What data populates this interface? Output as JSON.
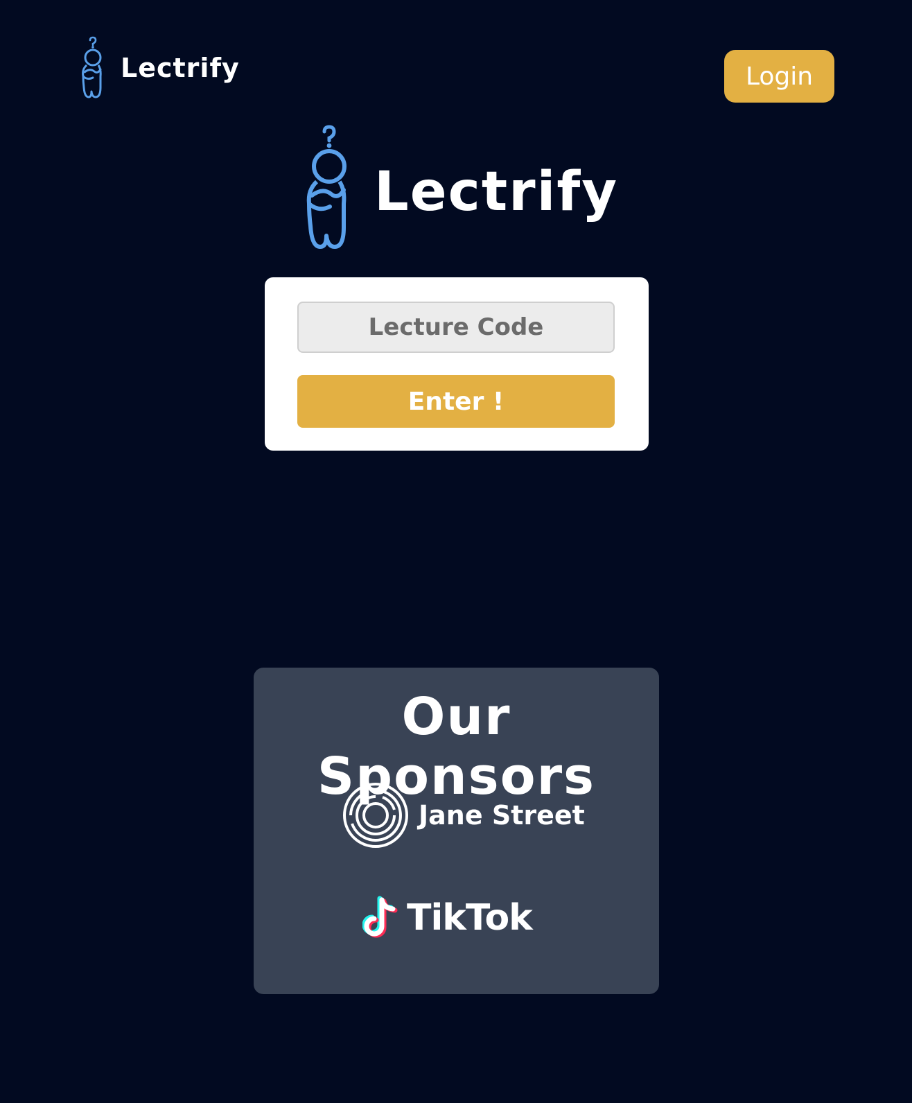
{
  "header": {
    "brand": "Lectrify",
    "logo_icon": "thinking-figure-icon",
    "login_label": "Login"
  },
  "hero": {
    "brand": "Lectrify",
    "logo_icon": "thinking-figure-icon"
  },
  "join_form": {
    "placeholder": "Lecture Code",
    "value": "",
    "enter_label": "Enter !"
  },
  "sponsors": {
    "title": "Our Sponsors",
    "items": [
      {
        "name": "Jane Street",
        "icon": "jane-street-logo-icon"
      },
      {
        "name": "TikTok",
        "icon": "tiktok-note-icon"
      }
    ]
  },
  "colors": {
    "background": "#020a21",
    "accent": "#e3b043",
    "logo_blue": "#5aa0ea",
    "panel": "#394355",
    "card": "#ffffff",
    "input_bg": "#ececec",
    "input_text": "#6b6b6b"
  }
}
